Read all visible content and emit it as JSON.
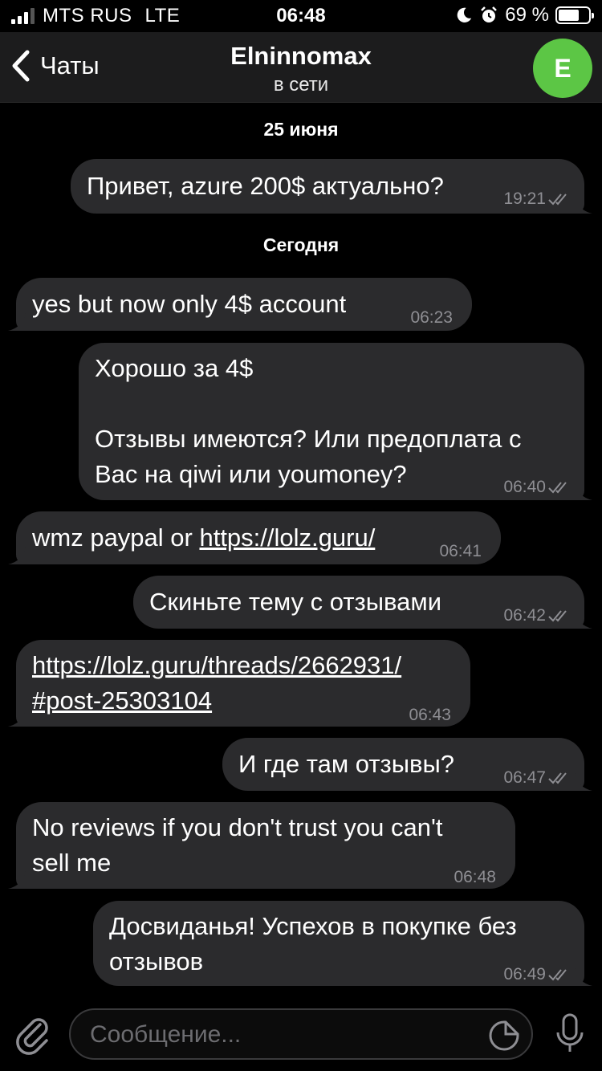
{
  "status_bar": {
    "carrier": "MTS RUS",
    "network": "LTE",
    "time": "06:48",
    "battery": "69 %",
    "battery_level": 0.69
  },
  "header": {
    "back_label": "Чаты",
    "title": "Elninnomax",
    "status": "в сети",
    "avatar_letter": "E",
    "avatar_color": "#5cc645"
  },
  "dates": {
    "first": "25 июня",
    "second": "Сегодня"
  },
  "messages": [
    {
      "direction": "out",
      "text": "Привет, azure 200$ актуально?",
      "time": "19:21",
      "read": true
    },
    {
      "direction": "in",
      "text": "yes but now only 4$ account",
      "time": "06:23"
    },
    {
      "direction": "out",
      "lines": [
        "Хорошо за 4$",
        "",
        "Отзывы имеются? Или предоплата с",
        "Вас на qiwi или youmoney?"
      ],
      "time": "06:40",
      "read": true
    },
    {
      "direction": "in",
      "prefix": "wmz paypal or ",
      "link": "https://lolz.guru/",
      "time": "06:41"
    },
    {
      "direction": "out",
      "text": "Скиньте тему с отзывами",
      "time": "06:42",
      "read": true
    },
    {
      "direction": "in",
      "link_lines": [
        "https://lolz.guru/threads/2662931/",
        "#post-25303104"
      ],
      "time": "06:43"
    },
    {
      "direction": "out",
      "text": "И где там отзывы?",
      "time": "06:47",
      "read": true
    },
    {
      "direction": "in",
      "lines": [
        "No reviews if you don't trust you can't",
        "sell me"
      ],
      "time": "06:48"
    },
    {
      "direction": "out",
      "lines": [
        "Досвиданья! Успехов в покупке без",
        "отзывов"
      ],
      "time": "06:49",
      "read": true
    }
  ],
  "input": {
    "placeholder": "Сообщение..."
  },
  "icons": {
    "back": "chevron-left-icon",
    "attach": "paperclip-icon",
    "sticker": "sticker-icon",
    "mic": "microphone-icon",
    "read": "double-check-icon"
  },
  "colors": {
    "background": "#000000",
    "bubble": "#2b2b2d",
    "header": "#1c1c1d",
    "meta": "#8e8e93"
  }
}
